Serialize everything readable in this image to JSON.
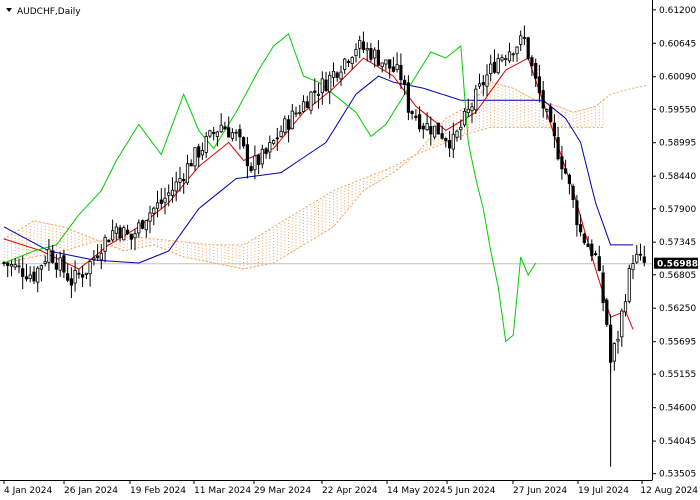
{
  "header": {
    "symbol": "AUDCHF,Daily"
  },
  "current_price_label": "0.56988",
  "colors": {
    "candle": "#000000",
    "tenkan": "#e00000",
    "kijun": "#0000b0",
    "chikou": "#00cc00",
    "cloud": "#f4a460",
    "price_line": "#c0c0c0",
    "price_box": "#000000"
  },
  "chart_data": {
    "type": "candlestick",
    "indicator": "Ichimoku Kinko Hyo",
    "y_ticks": [
      "0.61200",
      "0.60645",
      "0.60090",
      "0.59550",
      "0.58995",
      "0.58440",
      "0.57900",
      "0.57345",
      "0.56805",
      "0.56250",
      "0.55695",
      "0.55155",
      "0.54600",
      "0.54045",
      "0.53505"
    ],
    "ylim": [
      0.534,
      0.6133
    ],
    "x_ticks": [
      "4 Jan 2024",
      "26 Jan 2024",
      "19 Feb 2024",
      "11 Mar 2024",
      "29 Mar 2024",
      "22 Apr 2024",
      "14 May 2024",
      "5 Jun 2024",
      "27 Jun 2024",
      "19 Jul 2024",
      "12 Aug 2024"
    ],
    "current_price": 0.56988,
    "close_anchors": [
      [
        0,
        0.57
      ],
      [
        8,
        0.568
      ],
      [
        12,
        0.572
      ],
      [
        18,
        0.567
      ],
      [
        22,
        0.569
      ],
      [
        26,
        0.573
      ],
      [
        30,
        0.576
      ],
      [
        34,
        0.574
      ],
      [
        38,
        0.578
      ],
      [
        42,
        0.58
      ],
      [
        46,
        0.583
      ],
      [
        50,
        0.587
      ],
      [
        54,
        0.59
      ],
      [
        58,
        0.593
      ],
      [
        62,
        0.591
      ],
      [
        66,
        0.586
      ],
      [
        70,
        0.588
      ],
      [
        74,
        0.592
      ],
      [
        78,
        0.595
      ],
      [
        82,
        0.598
      ],
      [
        86,
        0.6
      ],
      [
        90,
        0.603
      ],
      [
        94,
        0.606
      ],
      [
        98,
        0.605
      ],
      [
        102,
        0.603
      ],
      [
        106,
        0.601
      ],
      [
        108,
        0.596
      ],
      [
        112,
        0.593
      ],
      [
        116,
        0.592
      ],
      [
        120,
        0.59
      ],
      [
        124,
        0.595
      ],
      [
        128,
        0.6
      ],
      [
        132,
        0.604
      ],
      [
        136,
        0.606
      ],
      [
        139,
        0.607
      ],
      [
        142,
        0.6
      ],
      [
        146,
        0.592
      ],
      [
        150,
        0.585
      ],
      [
        154,
        0.575
      ],
      [
        158,
        0.571
      ],
      [
        161,
        0.56
      ],
      [
        162,
        0.5535
      ],
      [
        164,
        0.558
      ],
      [
        166,
        0.565
      ],
      [
        168,
        0.571
      ],
      [
        171,
        0.5699
      ]
    ],
    "tenkan_anchors": [
      [
        0,
        0.574
      ],
      [
        10,
        0.572
      ],
      [
        20,
        0.569
      ],
      [
        28,
        0.573
      ],
      [
        36,
        0.576
      ],
      [
        44,
        0.58
      ],
      [
        52,
        0.586
      ],
      [
        60,
        0.59
      ],
      [
        64,
        0.587
      ],
      [
        72,
        0.589
      ],
      [
        80,
        0.595
      ],
      [
        88,
        0.599
      ],
      [
        96,
        0.604
      ],
      [
        104,
        0.601
      ],
      [
        110,
        0.596
      ],
      [
        118,
        0.592
      ],
      [
        126,
        0.595
      ],
      [
        134,
        0.602
      ],
      [
        140,
        0.604
      ],
      [
        146,
        0.593
      ],
      [
        152,
        0.582
      ],
      [
        158,
        0.569
      ],
      [
        162,
        0.561
      ],
      [
        166,
        0.562
      ],
      [
        168,
        0.559
      ]
    ],
    "kijun_anchors": [
      [
        0,
        0.576
      ],
      [
        12,
        0.572
      ],
      [
        24,
        0.5705
      ],
      [
        36,
        0.57
      ],
      [
        44,
        0.572
      ],
      [
        52,
        0.579
      ],
      [
        62,
        0.584
      ],
      [
        74,
        0.585
      ],
      [
        86,
        0.59
      ],
      [
        94,
        0.598
      ],
      [
        100,
        0.601
      ],
      [
        104,
        0.6
      ],
      [
        112,
        0.599
      ],
      [
        122,
        0.597
      ],
      [
        132,
        0.597
      ],
      [
        144,
        0.597
      ],
      [
        150,
        0.594
      ],
      [
        154,
        0.59
      ],
      [
        158,
        0.58
      ],
      [
        162,
        0.573
      ],
      [
        168,
        0.573
      ]
    ],
    "chikou_anchors": [
      [
        0,
        0.57
      ],
      [
        8,
        0.572
      ],
      [
        14,
        0.573
      ],
      [
        20,
        0.578
      ],
      [
        26,
        0.582
      ],
      [
        30,
        0.587
      ],
      [
        36,
        0.593
      ],
      [
        42,
        0.588
      ],
      [
        48,
        0.598
      ],
      [
        52,
        0.592
      ],
      [
        56,
        0.589
      ],
      [
        62,
        0.595
      ],
      [
        68,
        0.602
      ],
      [
        72,
        0.606
      ],
      [
        76,
        0.608
      ],
      [
        80,
        0.601
      ],
      [
        84,
        0.6
      ],
      [
        88,
        0.598
      ],
      [
        94,
        0.595
      ],
      [
        98,
        0.591
      ],
      [
        102,
        0.593
      ],
      [
        106,
        0.597
      ],
      [
        110,
        0.601
      ],
      [
        114,
        0.605
      ],
      [
        118,
        0.604
      ],
      [
        122,
        0.606
      ],
      [
        124,
        0.59
      ],
      [
        126,
        0.584
      ],
      [
        128,
        0.579
      ],
      [
        130,
        0.572
      ],
      [
        132,
        0.566
      ],
      [
        134,
        0.557
      ],
      [
        136,
        0.558
      ],
      [
        138,
        0.571
      ],
      [
        140,
        0.568
      ],
      [
        142,
        0.57
      ]
    ],
    "span_a_anchors": [
      [
        0,
        0.574
      ],
      [
        8,
        0.577
      ],
      [
        16,
        0.576
      ],
      [
        24,
        0.574
      ],
      [
        32,
        0.572
      ],
      [
        40,
        0.573
      ],
      [
        48,
        0.571
      ],
      [
        56,
        0.57
      ],
      [
        64,
        0.569
      ],
      [
        72,
        0.57
      ],
      [
        80,
        0.573
      ],
      [
        88,
        0.576
      ],
      [
        96,
        0.582
      ],
      [
        104,
        0.585
      ],
      [
        110,
        0.588
      ],
      [
        118,
        0.594
      ],
      [
        124,
        0.596
      ],
      [
        130,
        0.6
      ],
      [
        136,
        0.599
      ],
      [
        142,
        0.597
      ],
      [
        148,
        0.596
      ],
      [
        152,
        0.595
      ],
      [
        158,
        0.596
      ],
      [
        162,
        0.598
      ],
      [
        168,
        0.599
      ],
      [
        172,
        0.5995
      ]
    ],
    "span_b_anchors": [
      [
        0,
        0.57
      ],
      [
        8,
        0.571
      ],
      [
        16,
        0.572
      ],
      [
        24,
        0.5735
      ],
      [
        32,
        0.5745
      ],
      [
        40,
        0.574
      ],
      [
        48,
        0.5735
      ],
      [
        56,
        0.573
      ],
      [
        64,
        0.573
      ],
      [
        72,
        0.576
      ],
      [
        80,
        0.579
      ],
      [
        88,
        0.582
      ],
      [
        96,
        0.584
      ],
      [
        104,
        0.586
      ],
      [
        110,
        0.588
      ],
      [
        118,
        0.59
      ],
      [
        124,
        0.5915
      ],
      [
        130,
        0.5925
      ],
      [
        136,
        0.5925
      ],
      [
        142,
        0.5925
      ],
      [
        148,
        0.5925
      ],
      [
        152,
        0.5925
      ],
      [
        158,
        0.5925
      ],
      [
        160,
        0.5925
      ]
    ]
  }
}
